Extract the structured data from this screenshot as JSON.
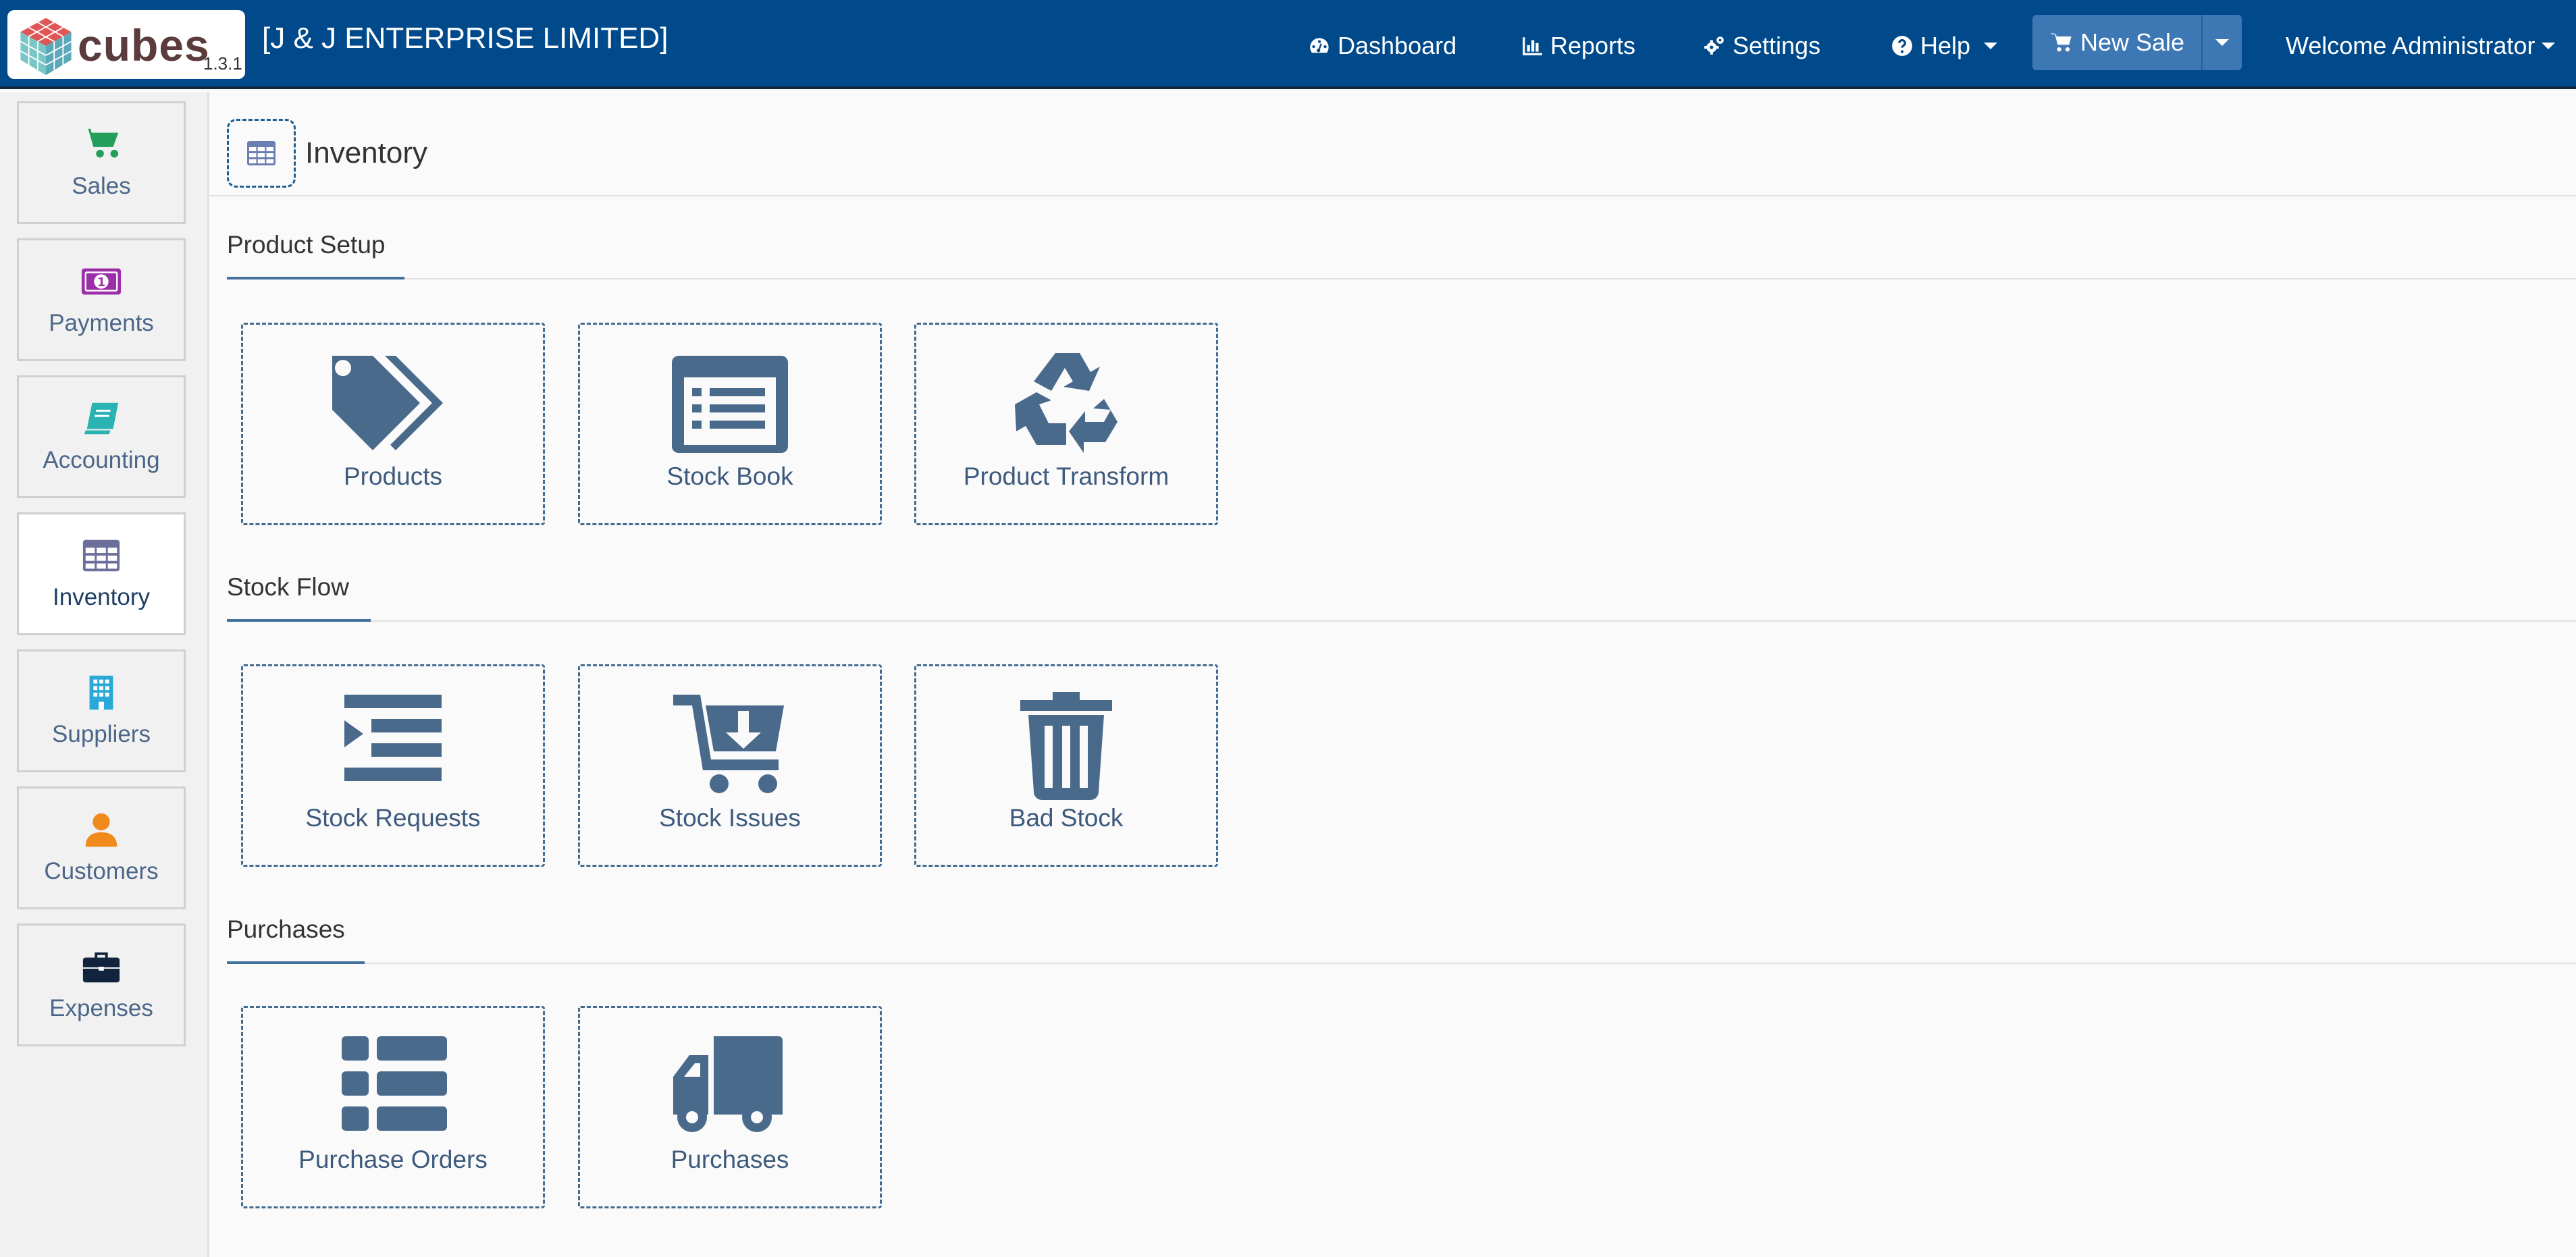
{
  "app": {
    "logo_word": "cubes",
    "version": "1.3.1",
    "company": "[J & J ENTERPRISE LIMITED]"
  },
  "nav": {
    "dashboard": "Dashboard",
    "reports": "Reports",
    "settings": "Settings",
    "help": "Help",
    "new_sale": "New Sale",
    "welcome": "Welcome Administrator"
  },
  "sidebar": {
    "items": [
      {
        "label": "Sales",
        "icon": "cart-icon",
        "color": "#22a05a"
      },
      {
        "label": "Payments",
        "icon": "money-icon",
        "color": "#9b2fa8"
      },
      {
        "label": "Accounting",
        "icon": "book-icon",
        "color": "#2bb3b3"
      },
      {
        "label": "Inventory",
        "icon": "table-icon",
        "color": "#6b6f9a",
        "active": true
      },
      {
        "label": "Suppliers",
        "icon": "building-icon",
        "color": "#2aa9d9"
      },
      {
        "label": "Customers",
        "icon": "user-icon",
        "color": "#f08a1c"
      },
      {
        "label": "Expenses",
        "icon": "briefcase-icon",
        "color": "#12243d"
      }
    ]
  },
  "page": {
    "title": "Inventory",
    "icon": "table-icon"
  },
  "sections": [
    {
      "title": "Product Setup",
      "tiles": [
        {
          "label": "Products",
          "icon": "tags-icon"
        },
        {
          "label": "Stock Book",
          "icon": "list-alt-icon"
        },
        {
          "label": "Product Transform",
          "icon": "recycle-icon"
        }
      ]
    },
    {
      "title": "Stock Flow",
      "tiles": [
        {
          "label": "Stock Requests",
          "icon": "indent-icon"
        },
        {
          "label": "Stock Issues",
          "icon": "cart-arrow-down-icon"
        },
        {
          "label": "Bad Stock",
          "icon": "trash-icon"
        }
      ]
    },
    {
      "title": "Purchases",
      "tiles": [
        {
          "label": "Purchase Orders",
          "icon": "th-list-icon"
        },
        {
          "label": "Purchases",
          "icon": "truck-icon"
        }
      ]
    }
  ]
}
